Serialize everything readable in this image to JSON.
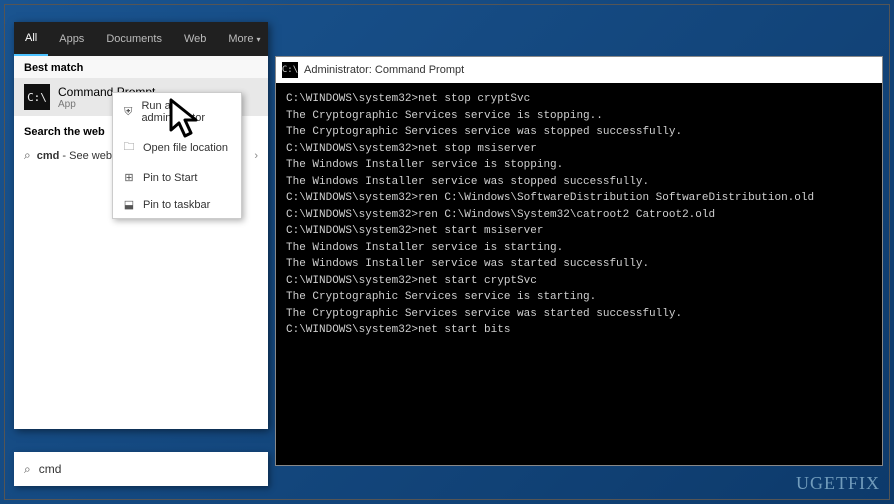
{
  "search": {
    "tabs": {
      "all": "All",
      "apps": "Apps",
      "documents": "Documents",
      "web": "Web",
      "more": "More"
    },
    "bestMatchHeader": "Best match",
    "bestMatch": {
      "title": "Command Prompt",
      "subtitle": "App"
    },
    "searchWebHeader": "Search the web",
    "webItem": {
      "prefix": "cmd",
      "suffix": " - See web results"
    },
    "input": "cmd"
  },
  "contextMenu": {
    "runAsAdmin": "Run as administrator",
    "openFile": "Open file location",
    "pinStart": "Pin to Start",
    "pinTaskbar": "Pin to taskbar"
  },
  "cmdWindow": {
    "title": "Administrator: Command Prompt",
    "lines": [
      "C:\\WINDOWS\\system32>net stop cryptSvc",
      "The Cryptographic Services service is stopping..",
      "The Cryptographic Services service was stopped successfully.",
      "",
      "",
      "C:\\WINDOWS\\system32>net stop msiserver",
      "The Windows Installer service is stopping.",
      "The Windows Installer service was stopped successfully.",
      "",
      "",
      "C:\\WINDOWS\\system32>ren C:\\Windows\\SoftwareDistribution SoftwareDistribution.old",
      "",
      "C:\\WINDOWS\\system32>ren C:\\Windows\\System32\\catroot2 Catroot2.old",
      "",
      "C:\\WINDOWS\\system32>net start msiserver",
      "The Windows Installer service is starting.",
      "The Windows Installer service was started successfully.",
      "",
      "",
      "C:\\WINDOWS\\system32>net start cryptSvc",
      "The Cryptographic Services service is starting.",
      "The Cryptographic Services service was started successfully.",
      "",
      "",
      "C:\\WINDOWS\\system32>net start bits"
    ]
  },
  "watermark": "UGETFIX"
}
